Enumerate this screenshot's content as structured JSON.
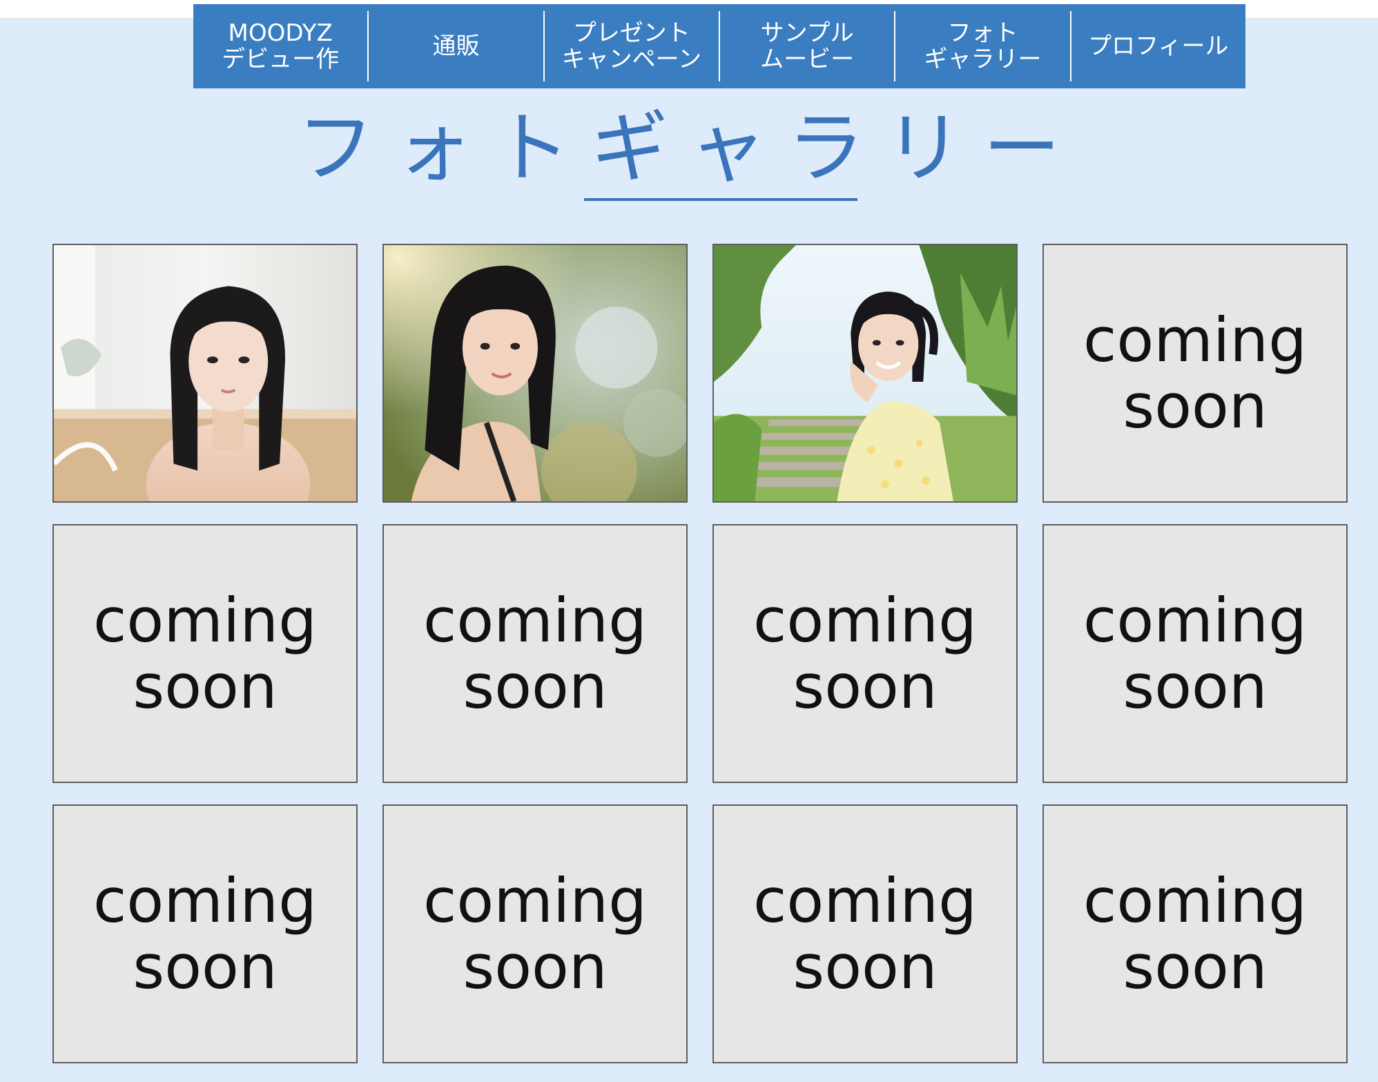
{
  "nav": {
    "items": [
      {
        "label": "MOODYZ\nデビュー作"
      },
      {
        "label": "通販"
      },
      {
        "label": "プレゼント\nキャンペーン"
      },
      {
        "label": "サンプル\nムービー"
      },
      {
        "label": "フォト\nギャラリー"
      },
      {
        "label": "プロフィール"
      }
    ]
  },
  "page": {
    "title": "フォトギャラリー"
  },
  "gallery": {
    "photos": [
      {
        "kind": "photo",
        "scene": "indoor-white-room",
        "accent": "#d9b48c"
      },
      {
        "kind": "photo",
        "scene": "sunlit-bokeh",
        "accent": "#c8a05a"
      },
      {
        "kind": "photo",
        "scene": "garden-steps",
        "accent": "#6fae48"
      }
    ],
    "placeholder_label": "coming\nsoon",
    "placeholders": [
      {
        "label": "coming\nsoon"
      },
      {
        "label": "coming\nsoon"
      },
      {
        "label": "coming\nsoon"
      },
      {
        "label": "coming\nsoon"
      },
      {
        "label": "coming\nsoon"
      },
      {
        "label": "coming\nsoon"
      },
      {
        "label": "coming\nsoon"
      },
      {
        "label": "coming\nsoon"
      },
      {
        "label": "coming\nsoon"
      }
    ]
  },
  "colors": {
    "background": "#ddebfa",
    "nav": "#3a7dc0",
    "title": "#3a74bb",
    "placeholder": "#e6e6e6"
  }
}
